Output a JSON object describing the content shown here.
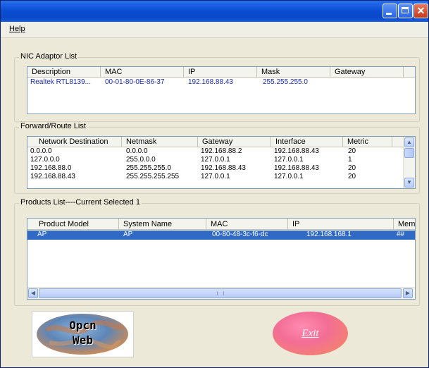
{
  "window": {
    "title": "",
    "controls": [
      "minimize-icon",
      "maximize-icon",
      "close-icon"
    ]
  },
  "menu": {
    "help": "Help"
  },
  "nic": {
    "title": "NIC Adaptor List",
    "headers": [
      "Description",
      "MAC",
      "IP",
      "Mask",
      "Gateway"
    ],
    "rows": [
      [
        "Realtek RTL8139...",
        "00-01-80-0E-86-37",
        "192.168.88.43",
        "255.255.255.0",
        ""
      ]
    ]
  },
  "route": {
    "title": "Forward/Route List",
    "headers": [
      "Network Destination",
      "Netmask",
      "Gateway",
      "Interface",
      "Metric"
    ],
    "rows": [
      [
        "0.0.0.0",
        "0.0.0.0",
        "192.168.88.2",
        "192.168.88.43",
        "20"
      ],
      [
        "127.0.0.0",
        "255.0.0.0",
        "127.0.0.1",
        "127.0.0.1",
        "1"
      ],
      [
        "192.168.88.0",
        "255.255.255.0",
        "192.168.88.43",
        "192.168.88.43",
        "20"
      ],
      [
        "192.168.88.43",
        "255.255.255.255",
        "127.0.0.1",
        "127.0.0.1",
        "20"
      ]
    ]
  },
  "products": {
    "title": "Products List----Current Selected 1",
    "headers": [
      "Product Model",
      "System Name",
      "MAC",
      "IP",
      "Mem"
    ],
    "rows": [
      [
        "AP",
        "AP",
        "00-80-48-3c-f6-dc",
        "192.168.168.1",
        "##"
      ]
    ]
  },
  "logo": {
    "line1": "Opcn",
    "line2": "Web"
  },
  "exit_label": "Exit",
  "colors": {
    "selection": "#316ac5",
    "nic_text": "#1a2bb5",
    "titlebar": "#0b4fd6"
  }
}
